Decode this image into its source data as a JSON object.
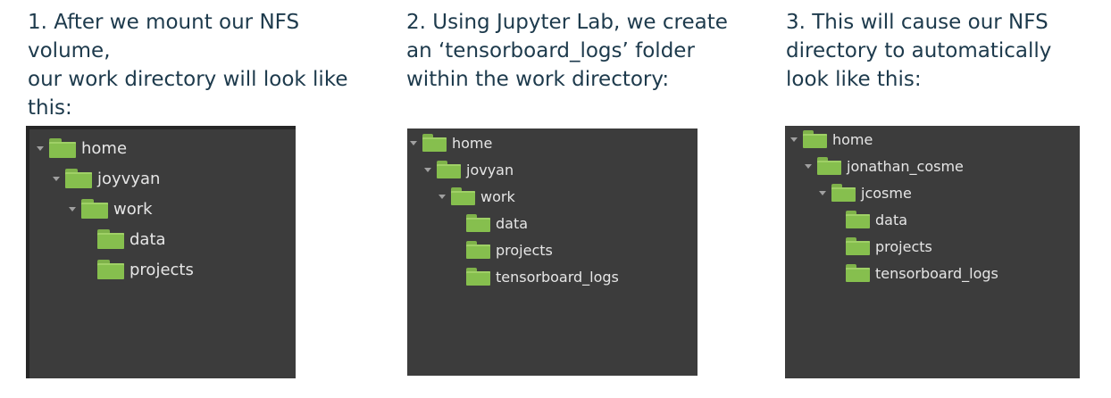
{
  "steps": [
    {
      "caption_lines": [
        "1. After we mount our NFS",
        "volume,",
        "our work directory will look like",
        "this:"
      ],
      "tree": [
        {
          "label": "home",
          "expanded": true
        },
        {
          "label": "joyvyan",
          "expanded": true
        },
        {
          "label": "work",
          "expanded": true
        },
        {
          "label": "data",
          "expanded": false
        },
        {
          "label": "projects",
          "expanded": false
        }
      ]
    },
    {
      "caption_lines": [
        "2. Using Jupyter Lab, we create",
        "an ‘tensorboard_logs’ folder",
        "within the work directory:"
      ],
      "tree": [
        {
          "label": "home",
          "expanded": true
        },
        {
          "label": "jovyan",
          "expanded": true
        },
        {
          "label": "work",
          "expanded": true
        },
        {
          "label": "data",
          "expanded": false
        },
        {
          "label": "projects",
          "expanded": false
        },
        {
          "label": "tensorboard_logs",
          "expanded": false
        }
      ]
    },
    {
      "caption_lines": [
        "3. This will cause our NFS",
        "directory to automatically",
        "look like this:"
      ],
      "tree": [
        {
          "label": "home",
          "expanded": true
        },
        {
          "label": "jonathan_cosme",
          "expanded": true
        },
        {
          "label": "jcosme",
          "expanded": true
        },
        {
          "label": "data",
          "expanded": false
        },
        {
          "label": "projects",
          "expanded": false
        },
        {
          "label": "tensorboard_logs",
          "expanded": false
        }
      ]
    }
  ],
  "colors": {
    "caption_text": "#1d3a4c",
    "panel_bg": "#3c3c3c",
    "folder": "#86bf4e",
    "tree_text": "#e6e6e6"
  },
  "icons": {
    "expand_arrow": "chevron-down-icon",
    "folder": "folder-icon"
  }
}
